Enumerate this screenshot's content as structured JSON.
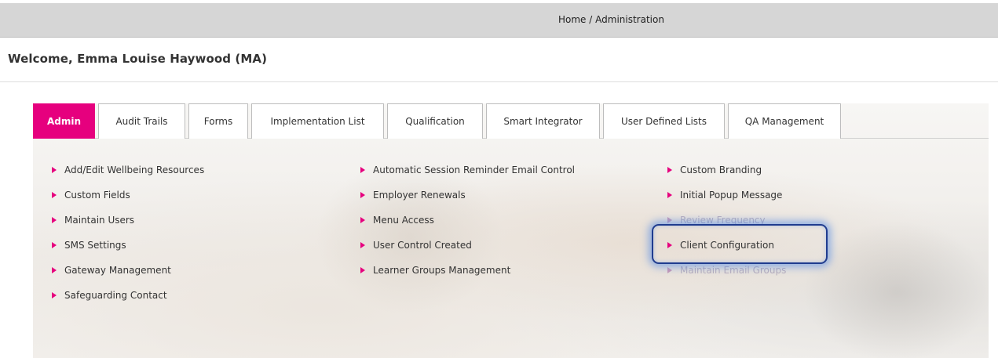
{
  "breadcrumb": {
    "home": "Home",
    "separator": "/",
    "current": "Administration"
  },
  "welcome": "Welcome, Emma Louise Haywood (MA)",
  "tabs": [
    {
      "label": "Admin",
      "active": true
    },
    {
      "label": "Audit Trails"
    },
    {
      "label": "Forms"
    },
    {
      "label": "Implementation List"
    },
    {
      "label": "Qualification"
    },
    {
      "label": "Smart Integrator"
    },
    {
      "label": "User Defined Lists"
    },
    {
      "label": "QA Management"
    }
  ],
  "menu": {
    "col1": [
      "Add/Edit Wellbeing Resources",
      "Custom Fields",
      "Maintain Users",
      "SMS Settings",
      "Gateway Management",
      "Safeguarding Contact"
    ],
    "col2": [
      "Automatic Session Reminder Email Control",
      "Employer Renewals",
      "Menu Access",
      "User Control Created",
      "Learner Groups Management"
    ],
    "col3": [
      "Custom Branding",
      "Initial Popup Message",
      "Review Frequency",
      "Client Configuration",
      "Maintain Email Groups"
    ]
  },
  "colors": {
    "accent": "#e6007e",
    "highlight_border": "#1f3c8f"
  },
  "icons": {
    "menu_bullet": "triangle-right-icon"
  }
}
